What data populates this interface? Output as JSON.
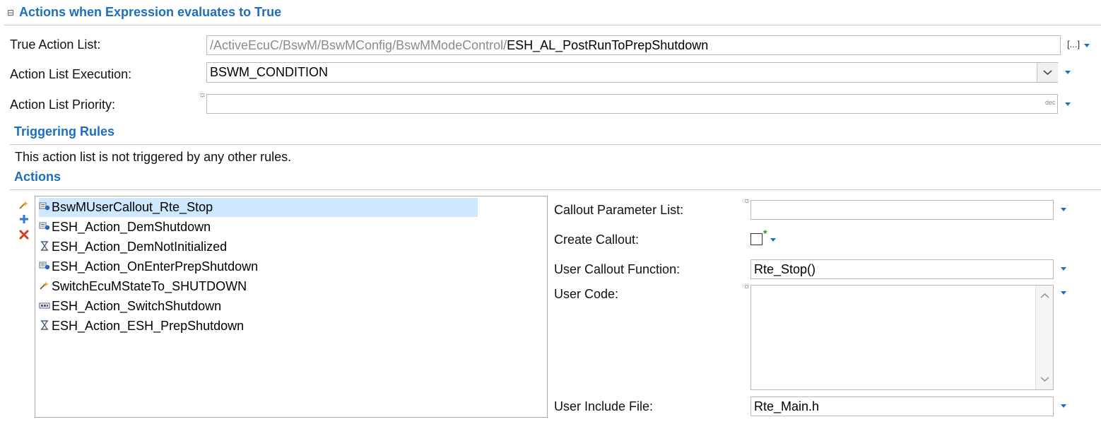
{
  "header": {
    "section_title": "Actions when Expression evaluates to True",
    "collapse_glyph": "⊟"
  },
  "form": {
    "true_action_list": {
      "label": "True Action List:",
      "value_path": "/ActiveEcuC/BswM/BswMConfig/BswMModeControl/",
      "value_name": "ESH_AL_PostRunToPrepShutdown",
      "browse_label": "[...]"
    },
    "action_list_execution": {
      "label": "Action List Execution:",
      "value": "BSWM_CONDITION"
    },
    "action_list_priority": {
      "label": "Action List Priority:",
      "value": "",
      "unit_hint": "dec"
    }
  },
  "triggering_rules": {
    "title": "Triggering Rules",
    "message": "This action list is not triggered by any other rules."
  },
  "actions": {
    "title": "Actions",
    "items": [
      {
        "label": "BswMUserCallout_Rte_Stop",
        "icon": "callout-icon",
        "selected": true
      },
      {
        "label": "ESH_Action_DemShutdown",
        "icon": "callout-icon",
        "selected": false
      },
      {
        "label": "ESH_Action_DemNotInitialized",
        "icon": "hourglass-icon",
        "selected": false
      },
      {
        "label": "ESH_Action_OnEnterPrepShutdown",
        "icon": "callout-icon",
        "selected": false
      },
      {
        "label": "SwitchEcuMStateTo_SHUTDOWN",
        "icon": "switch-state-icon",
        "selected": false
      },
      {
        "label": "ESH_Action_SwitchShutdown",
        "icon": "mode-switch-icon",
        "selected": false
      },
      {
        "label": "ESH_Action_ESH_PrepShutdown",
        "icon": "hourglass-icon",
        "selected": false
      }
    ]
  },
  "details": {
    "callout_parameter_list": {
      "label": "Callout Parameter List:",
      "value": ""
    },
    "create_callout": {
      "label": "Create Callout:",
      "checked": false,
      "modified_mark": "*"
    },
    "user_callout_function": {
      "label": "User Callout Function:",
      "value": "Rte_Stop()"
    },
    "user_code": {
      "label": "User Code:",
      "value": ""
    },
    "user_include_file": {
      "label": "User Include File:",
      "value": "Rte_Main.h"
    }
  },
  "colors": {
    "accent": "#1d6fbd",
    "selection": "#cde8ff",
    "border": "#b9b9b9"
  }
}
